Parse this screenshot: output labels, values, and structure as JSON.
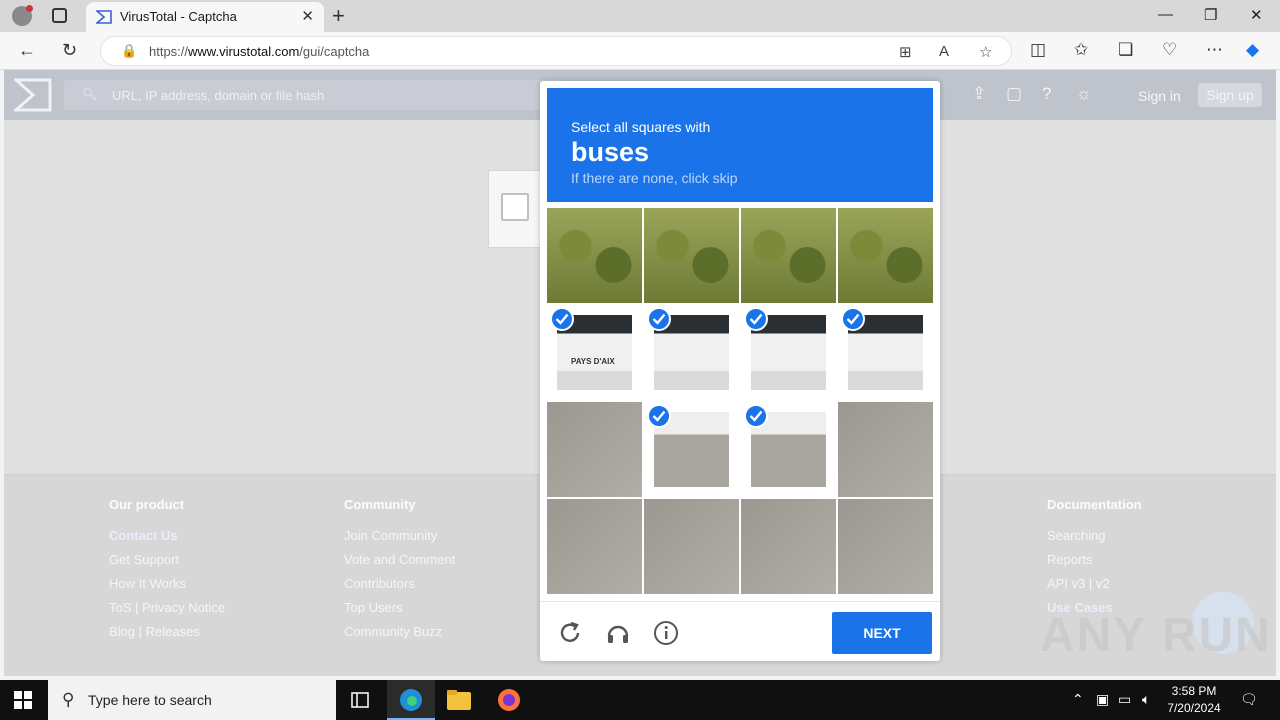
{
  "browser": {
    "tab_title": "VirusTotal - Captcha",
    "url_prefix": "https://",
    "url_domain": "www.virustotal.com",
    "url_path": "/gui/captcha",
    "new_tab_glyph": "+",
    "close_glyph": "✕"
  },
  "vt": {
    "search_placeholder": "URL, IP address, domain or file hash",
    "sign_in": "Sign in",
    "sign_up": "Sign up"
  },
  "footer": {
    "product": {
      "heading": "Our product",
      "items": [
        "Contact Us",
        "Get Support",
        "How It Works",
        "ToS | Privacy Notice",
        "Blog | Releases"
      ]
    },
    "community": {
      "heading": "Community",
      "items": [
        "Join Community",
        "Vote and Comment",
        "Contributors",
        "Top Users",
        "Community Buzz"
      ]
    },
    "documentation": {
      "heading": "Documentation",
      "items": [
        "Searching",
        "Reports",
        "API v3 | v2",
        "Use Cases"
      ]
    }
  },
  "captcha": {
    "prompt": "Select all squares with",
    "target": "buses",
    "hint": "If there are none, click skip",
    "bus_label": "PAYS D'AIX",
    "next_label": "NEXT",
    "grid": [
      [
        "trees",
        false
      ],
      [
        "trees",
        false
      ],
      [
        "trees",
        false
      ],
      [
        "trees",
        false
      ],
      [
        "bus",
        true
      ],
      [
        "bus",
        true
      ],
      [
        "bus",
        true
      ],
      [
        "bus",
        true
      ],
      [
        "road",
        false
      ],
      [
        "roadbus",
        true
      ],
      [
        "roadbus",
        true
      ],
      [
        "road",
        false
      ],
      [
        "road",
        false
      ],
      [
        "road",
        false
      ],
      [
        "road",
        false
      ],
      [
        "road",
        false
      ]
    ],
    "accent": "#1a73e8"
  },
  "watermark": "ANY RUN",
  "taskbar": {
    "search_placeholder": "Type here to search",
    "time": "3:58 PM",
    "date": "7/20/2024"
  }
}
